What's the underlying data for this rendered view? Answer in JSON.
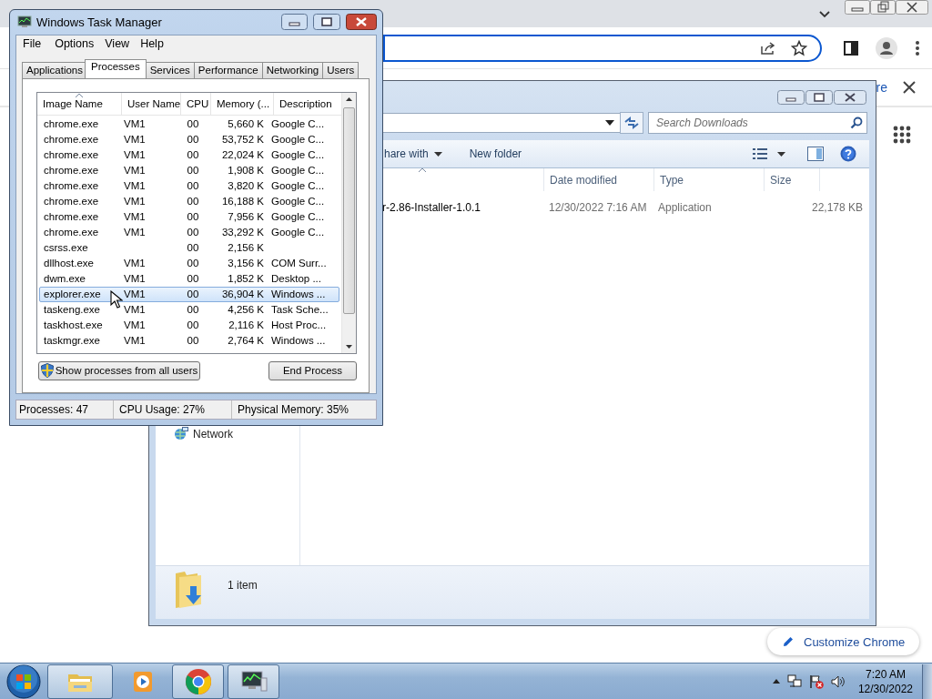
{
  "browser": {
    "banner_link": "re",
    "customize_button": "Customize Chrome"
  },
  "explorer": {
    "search_placeholder": "Search Downloads",
    "toolbar": [
      {
        "label": "hare with",
        "kind": "menu"
      },
      {
        "label": "New folder",
        "kind": "plain"
      }
    ],
    "name_column_sorted": true,
    "columns": [
      "Date modified",
      "Type",
      "Size"
    ],
    "files": [
      {
        "name": "r-2.86-Installer-1.0.1",
        "date": "12/30/2022 7:16 AM",
        "type": "Application",
        "size": "22,178 KB"
      }
    ],
    "nav": [
      {
        "label": "Network"
      }
    ],
    "status": "1 item"
  },
  "task_manager": {
    "title": "Windows Task Manager",
    "menu": [
      "File",
      "Options",
      "View",
      "Help"
    ],
    "tabs": [
      {
        "label": "Applications",
        "selected": false
      },
      {
        "label": "Processes",
        "selected": true
      },
      {
        "label": "Services",
        "selected": false
      },
      {
        "label": "Performance",
        "selected": false
      },
      {
        "label": "Networking",
        "selected": false
      },
      {
        "label": "Users",
        "selected": false
      }
    ],
    "columns": [
      {
        "label": "Image Name",
        "sorted": true
      },
      {
        "label": "User Name",
        "sorted": false
      },
      {
        "label": "CPU",
        "sorted": false
      },
      {
        "label": "Memory (...",
        "sorted": false
      },
      {
        "label": "Description",
        "sorted": false
      }
    ],
    "rows": [
      {
        "image": "chrome.exe",
        "user": "VM1",
        "cpu": "00",
        "memory": "5,660 K",
        "description": "Google C...",
        "selected": false
      },
      {
        "image": "chrome.exe",
        "user": "VM1",
        "cpu": "00",
        "memory": "53,752 K",
        "description": "Google C...",
        "selected": false
      },
      {
        "image": "chrome.exe",
        "user": "VM1",
        "cpu": "00",
        "memory": "22,024 K",
        "description": "Google C...",
        "selected": false
      },
      {
        "image": "chrome.exe",
        "user": "VM1",
        "cpu": "00",
        "memory": "1,908 K",
        "description": "Google C...",
        "selected": false
      },
      {
        "image": "chrome.exe",
        "user": "VM1",
        "cpu": "00",
        "memory": "3,820 K",
        "description": "Google C...",
        "selected": false
      },
      {
        "image": "chrome.exe",
        "user": "VM1",
        "cpu": "00",
        "memory": "16,188 K",
        "description": "Google C...",
        "selected": false
      },
      {
        "image": "chrome.exe",
        "user": "VM1",
        "cpu": "00",
        "memory": "7,956 K",
        "description": "Google C...",
        "selected": false
      },
      {
        "image": "chrome.exe",
        "user": "VM1",
        "cpu": "00",
        "memory": "33,292 K",
        "description": "Google C...",
        "selected": false
      },
      {
        "image": "csrss.exe",
        "cpu": "00",
        "memory": "2,156 K",
        "selected": false
      },
      {
        "image": "dllhost.exe",
        "user": "VM1",
        "cpu": "00",
        "memory": "3,156 K",
        "description": "COM Surr...",
        "selected": false
      },
      {
        "image": "dwm.exe",
        "user": "VM1",
        "cpu": "00",
        "memory": "1,852 K",
        "description": "Desktop ...",
        "selected": false
      },
      {
        "image": "explorer.exe",
        "user": "VM1",
        "cpu": "00",
        "memory": "36,904 K",
        "description": "Windows ...",
        "selected": true
      },
      {
        "image": "taskeng.exe",
        "user": "VM1",
        "cpu": "00",
        "memory": "4,256 K",
        "description": "Task Sche...",
        "selected": false
      },
      {
        "image": "taskhost.exe",
        "user": "VM1",
        "cpu": "00",
        "memory": "2,116 K",
        "description": "Host Proc...",
        "selected": false
      },
      {
        "image": "taskmgr.exe",
        "user": "VM1",
        "cpu": "00",
        "memory": "2,764 K",
        "description": "Windows ...",
        "selected": false
      }
    ],
    "show_all_button": "Show processes from all users",
    "end_button": "End Process",
    "status": [
      "Processes: 47",
      "CPU Usage: 27%",
      "Physical Memory: 35%"
    ]
  },
  "taskbar": {
    "apps": [
      {
        "kind": "folder",
        "running": true
      },
      {
        "kind": "media",
        "running": false
      },
      {
        "kind": "browser",
        "running": true
      },
      {
        "kind": "monitor",
        "running": true
      }
    ],
    "time": "7:20 AM",
    "date": "12/30/2022"
  }
}
